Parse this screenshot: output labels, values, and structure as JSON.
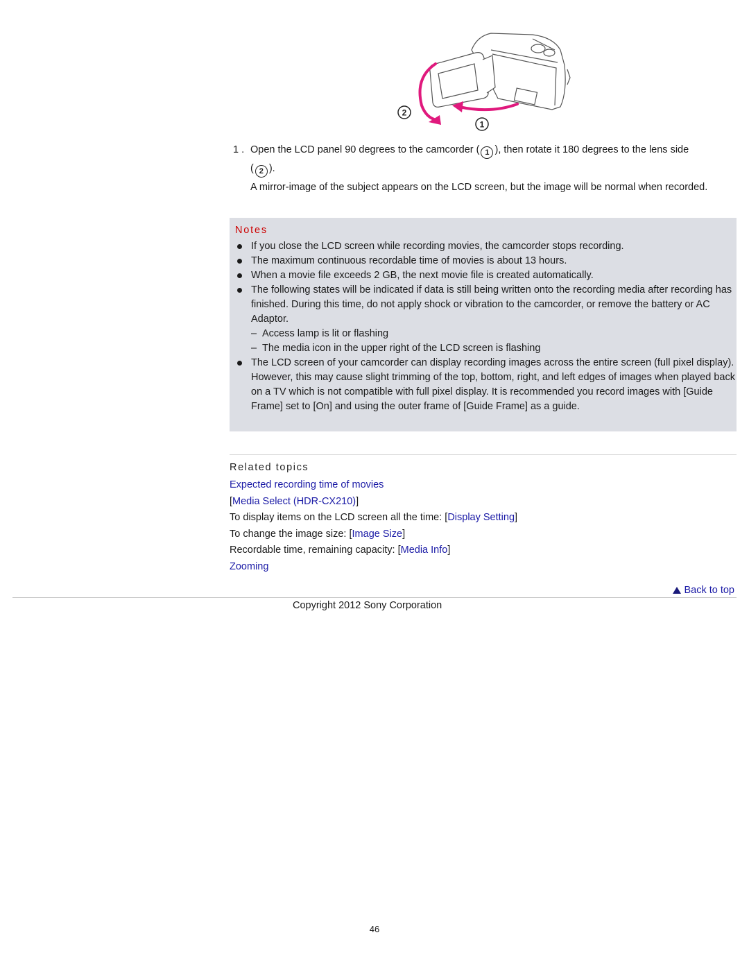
{
  "figure": {
    "alt": "Camcorder with LCD panel opened 90 degrees and rotated 180 degrees",
    "callouts": [
      "1",
      "2"
    ],
    "arrow_color": "#e0197d"
  },
  "step": {
    "number": "1 .",
    "text_before": "Open the LCD panel 90 degrees to the camcorder (",
    "marker1": "1",
    "text_middle": "), then rotate it 180 degrees to the lens side",
    "line2_open": "(",
    "marker2": "2",
    "line2_close": ").",
    "description": "A mirror-image of the subject appears on the LCD screen, but the image will be normal when recorded."
  },
  "notes": {
    "title": "Notes",
    "title_color": "#cc0000",
    "background": "#dcdee4",
    "items": [
      {
        "text": "If you close the LCD screen while recording movies, the camcorder stops recording."
      },
      {
        "text": "The maximum continuous recordable time of movies is about 13 hours."
      },
      {
        "text": "When a movie file exceeds 2 GB, the next movie file is created automatically."
      },
      {
        "text": "The following states will be indicated if data is still being written onto the recording media after recording has finished. During this time, do not apply shock or vibration to the camcorder, or remove the battery or AC Adaptor.",
        "subitems": [
          "Access lamp is lit or flashing",
          "The media icon in the upper right of the LCD screen is flashing"
        ]
      },
      {
        "text": "The LCD screen of your camcorder can display recording images across the entire screen (full pixel display). However, this may cause slight trimming of the top, bottom, right, and left edges of images when played back on a TV which is not compatible with full pixel display. It is recommended you record images with [Guide Frame] set to [On] and using the outer frame of [Guide Frame] as a guide."
      }
    ]
  },
  "related": {
    "title": "Related topics",
    "rows": [
      {
        "prefix": "",
        "open": "",
        "link": "Expected recording time of movies",
        "close": ""
      },
      {
        "prefix": "",
        "open": "[",
        "link": "Media Select (HDR-CX210)",
        "close": "]"
      },
      {
        "prefix": "To display items on the LCD screen all the time: ",
        "open": "[",
        "link": "Display Setting",
        "close": "]"
      },
      {
        "prefix": "To change the image size: ",
        "open": "[",
        "link": "Image Size",
        "close": "]"
      },
      {
        "prefix": "Recordable time, remaining capacity: ",
        "open": "[",
        "link": "Media Info",
        "close": "]"
      },
      {
        "prefix": "",
        "open": "",
        "link": "Zooming",
        "close": ""
      }
    ]
  },
  "footer": {
    "back_to_top": "Back to top",
    "copyright": "Copyright 2012 Sony Corporation",
    "page_number": "46"
  },
  "colors": {
    "link": "#1a1aa6"
  }
}
